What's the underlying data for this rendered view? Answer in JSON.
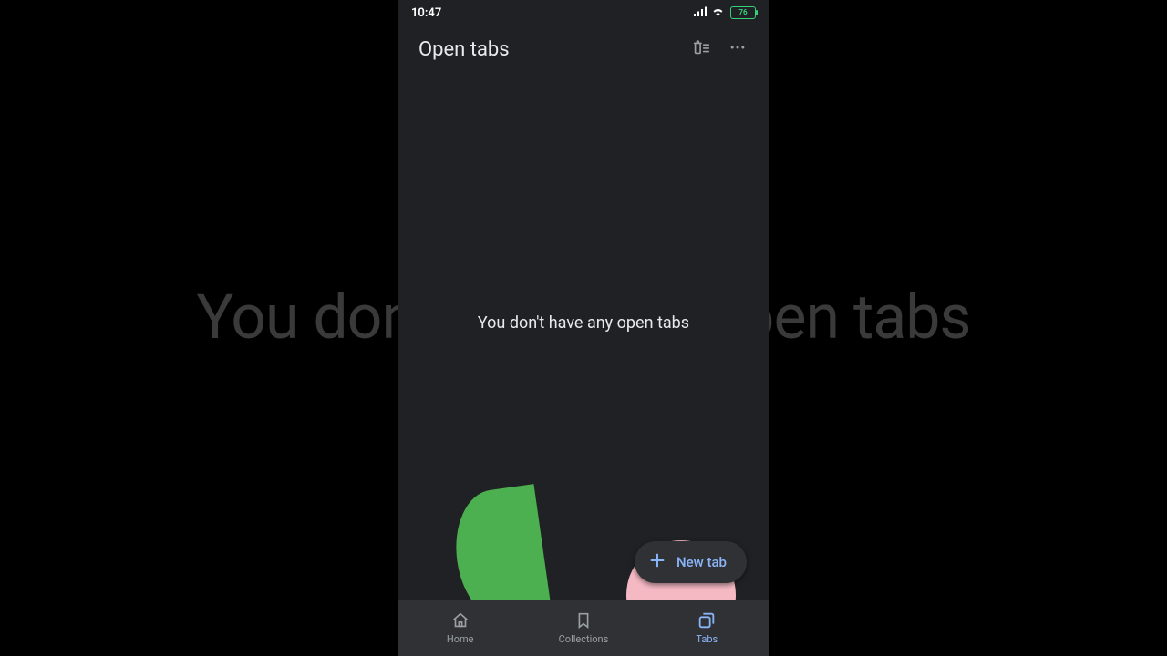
{
  "status_bar": {
    "time": "10:47",
    "battery_level": "76"
  },
  "header": {
    "title": "Open tabs"
  },
  "main": {
    "empty_state_message": "You don't have any open tabs"
  },
  "fab": {
    "label": "New tab"
  },
  "bottom_nav": {
    "items": [
      {
        "label": "Home"
      },
      {
        "label": "Collections"
      },
      {
        "label": "Tabs"
      }
    ],
    "active_index": 2
  },
  "background": {
    "echo_text": "You don't have any open tabs"
  }
}
